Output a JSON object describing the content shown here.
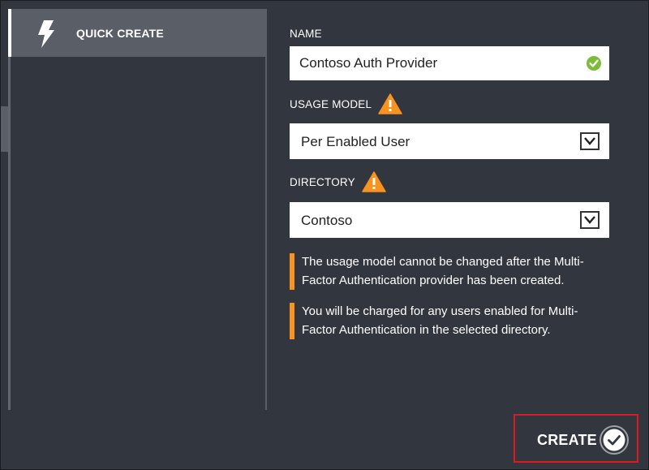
{
  "nav": {
    "quick_create_label": "QUICK CREATE"
  },
  "form": {
    "name": {
      "label": "NAME",
      "value": "Contoso Auth Provider",
      "status_icon": "check-circle-icon"
    },
    "usage_model": {
      "label": "USAGE MODEL",
      "warning_icon": "warning-icon",
      "selected": "Per Enabled User"
    },
    "directory": {
      "label": "DIRECTORY",
      "warning_icon": "warning-icon",
      "selected": "Contoso"
    },
    "notices": [
      {
        "text": "The usage model cannot be changed after the Multi-Factor Authentication provider has been created."
      },
      {
        "text": "You will be charged for any users enabled for Multi-Factor Authentication in the selected directory."
      }
    ]
  },
  "actions": {
    "create_label": "CREATE"
  },
  "colors": {
    "background": "#32363f",
    "panel_selected": "#5a5e66",
    "accent_warning": "#f7931e",
    "valid": "#7cbb3b",
    "highlight_border": "#e0191e"
  }
}
